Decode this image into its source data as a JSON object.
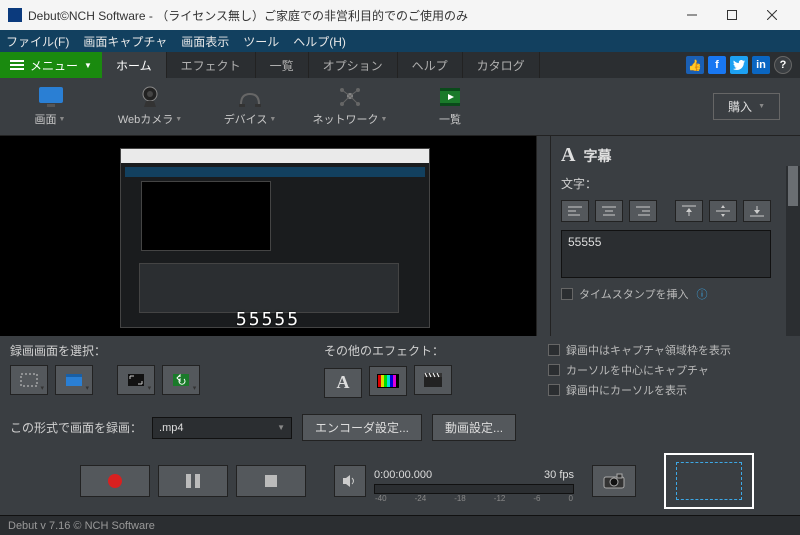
{
  "title": "Debut©NCH Software - （ライセンス無し）ご家庭での非営利目的でのご使用のみ",
  "menubar": {
    "file": "ファイル(F)",
    "capture": "画面キャプチャ",
    "display": "画面表示",
    "tools": "ツール",
    "help": "ヘルプ(H)"
  },
  "menu_button": "メニュー",
  "tabs": {
    "home": "ホーム",
    "effects": "エフェクト",
    "list": "一覧",
    "options": "オプション",
    "help": "ヘルプ",
    "catalog": "カタログ"
  },
  "ribbon": {
    "screen": "画面",
    "webcam": "Webカメラ",
    "device": "デバイス",
    "network": "ネットワーク",
    "list": "一覧",
    "buy": "購入"
  },
  "caption": {
    "header": "字幕",
    "text_label": "文字：",
    "text_value": "55555",
    "timestamp": "タイムスタンプを挿入"
  },
  "preview_caption": "55555",
  "select_area": {
    "label": "録画画面を選択："
  },
  "other_effects": {
    "label": "その他のエフェクト："
  },
  "checks": {
    "show_region": "録画中はキャプチャ領域枠を表示",
    "center_cursor": "カーソルを中心にキャプチャ",
    "show_cursor": "録画中にカーソルを表示"
  },
  "format": {
    "label": "この形式で画面を録画：",
    "value": ".mp4",
    "encoder": "エンコーダ設定...",
    "video": "動画設定..."
  },
  "transport": {
    "time": "0:00:00.000",
    "fps": "30 fps",
    "ticks": [
      "-40",
      "-24",
      "-18",
      "-12",
      "-6",
      "0"
    ]
  },
  "status": "Debut v 7.16 © NCH Software"
}
